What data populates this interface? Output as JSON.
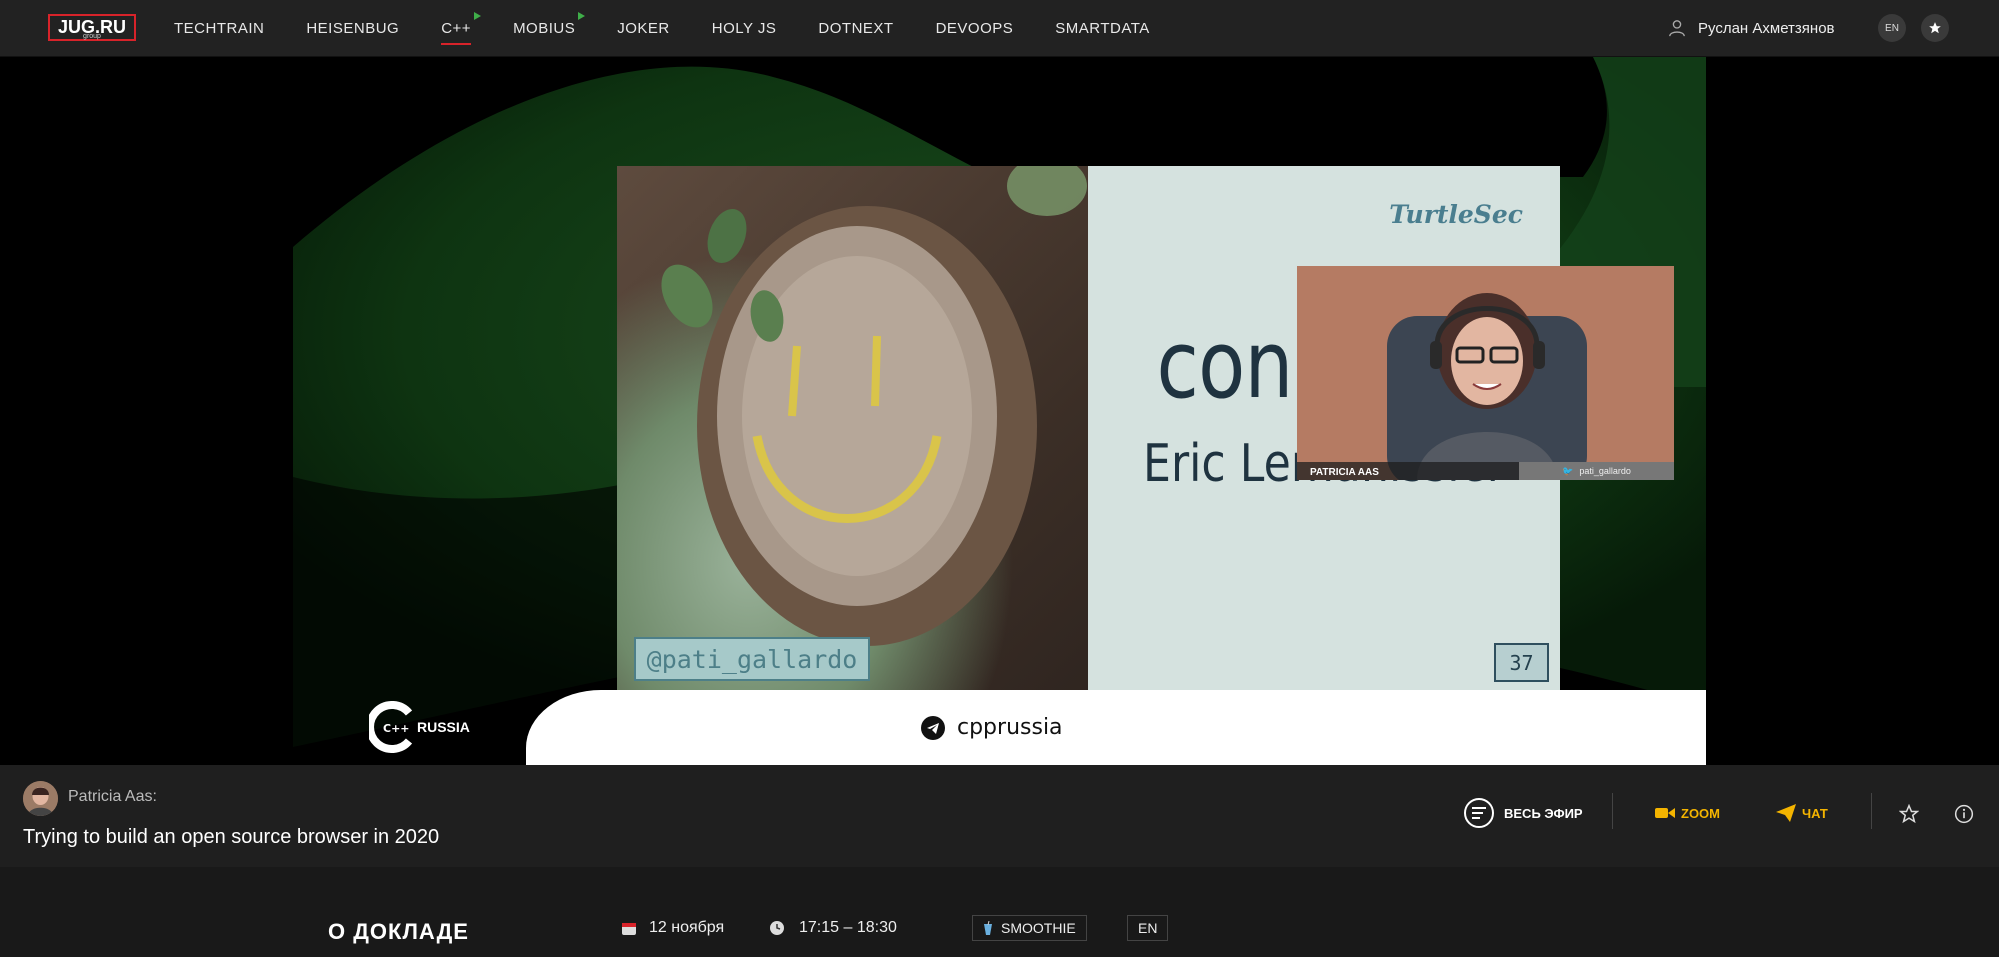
{
  "header": {
    "logo_text": "JUG.RU",
    "logo_sub": "group",
    "nav": [
      {
        "label": "TECHTRAIN"
      },
      {
        "label": "HEISENBUG"
      },
      {
        "label": "C++"
      },
      {
        "label": "MOBIUS"
      },
      {
        "label": "JOKER"
      },
      {
        "label": "HOLY JS"
      },
      {
        "label": "DOTNEXT"
      },
      {
        "label": "DEVOOPS"
      },
      {
        "label": "SMARTDATA"
      }
    ],
    "user_name": "Руслан Ахметзянов",
    "lang": "EN"
  },
  "slide": {
    "brand": "TurtleSec",
    "title": "conan-qt",
    "subtitle": "Eric Lemanissier",
    "handle": "@pati_gallardo",
    "page_number": "37"
  },
  "camera": {
    "name": "PATRICIA AAS",
    "twitter": "pati_gallardo"
  },
  "stream_branding": {
    "logo_text": "RUSSIA",
    "telegram": "cpprussia"
  },
  "info": {
    "speaker": "Patricia Aas:",
    "title": "Trying to build an open source browser in 2020",
    "all_stream_label": "ВЕСЬ ЭФИР",
    "zoom_label": "ZOOM",
    "chat_label": "ЧАТ"
  },
  "details": {
    "heading": "О ДОКЛАДЕ",
    "date": "12 ноября",
    "time": "17:15 – 18:30",
    "room": "SMOOTHIE",
    "lang": "EN"
  },
  "colors": {
    "accent_red": "#d8232a",
    "accent_green": "#3fae49",
    "accent_yellow": "#f4b400"
  }
}
